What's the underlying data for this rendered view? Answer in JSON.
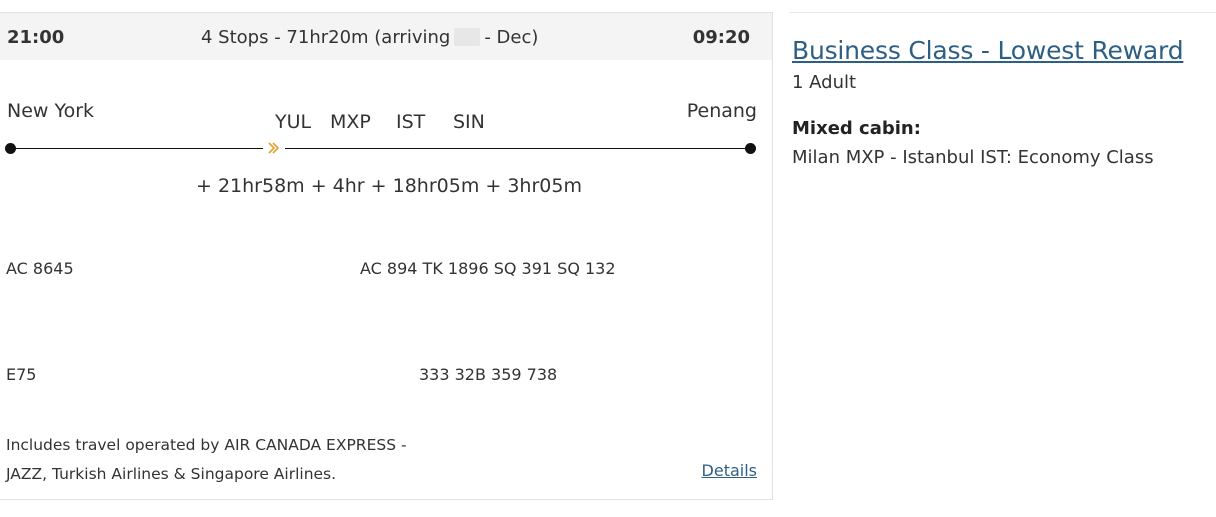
{
  "itinerary": {
    "departure_time": "21:00",
    "arrival_time": "09:20",
    "summary_prefix": "4 Stops - 71hr20m (arriving",
    "summary_suffix": "- Dec)",
    "origin_city": "New York",
    "destination_city": "Penang",
    "stops": [
      "YUL",
      "MXP",
      "IST",
      "SIN"
    ],
    "layovers": "+ 21hr58m + 4hr + 18hr05m + 3hr05m",
    "first_flight": "AC 8645",
    "other_flights": "AC 894 TK 1896 SQ 391 SQ 132",
    "first_aircraft": "E75",
    "other_aircraft": "333 32B 359 738",
    "operated_line1": "Includes travel operated by AIR CANADA EXPRESS -",
    "operated_line2": "JAZZ, Turkish Airlines & Singapore Airlines.",
    "details_label": "Details",
    "plane_icon": "plane-icon"
  },
  "fare": {
    "title": "Business Class - Lowest Reward",
    "passengers": "1 Adult",
    "mixed_cabin_label": "Mixed cabin:",
    "mixed_cabin_detail": "Milan MXP - Istanbul IST: Economy Class"
  },
  "colors": {
    "link": "#2d5f83",
    "header_bg": "#f4f4f4",
    "plane_accent": "#e3a32b"
  }
}
